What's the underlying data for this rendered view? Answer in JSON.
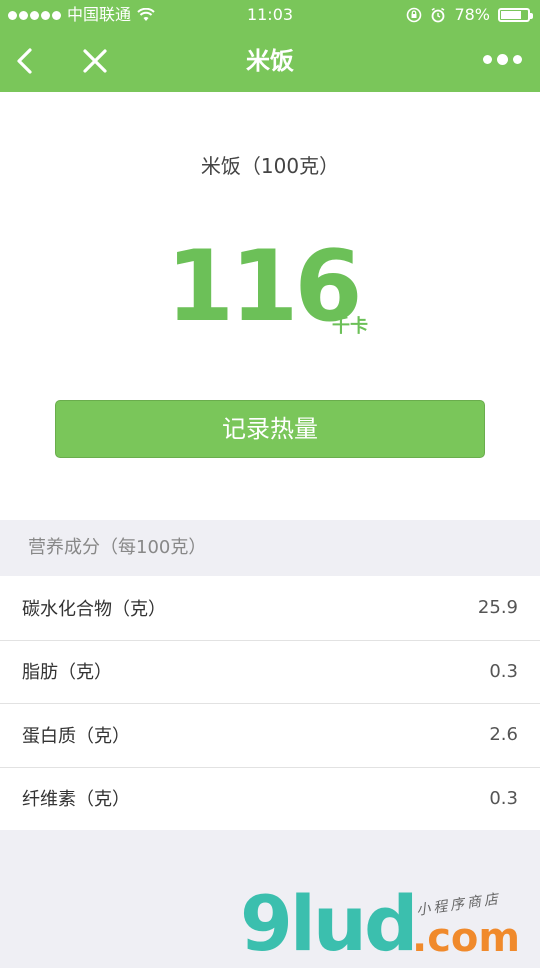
{
  "status_bar": {
    "carrier": "中国联通",
    "time": "11:03",
    "battery": "78%",
    "battery_level": 0.78
  },
  "nav": {
    "title": "米饭"
  },
  "food": {
    "name": "米饭（100克）",
    "calories": "116",
    "calories_unit": "千卡",
    "record_button_label": "记录热量"
  },
  "nutrition": {
    "header": "营养成分（每100克）",
    "rows": [
      {
        "label": "碳水化合物（克）",
        "value": "25.9"
      },
      {
        "label": "脂肪（克）",
        "value": "0.3"
      },
      {
        "label": "蛋白质（克）",
        "value": "2.6"
      },
      {
        "label": "纤维素（克）",
        "value": "0.3"
      }
    ]
  },
  "watermark": {
    "main": "9lud",
    "com": ".com",
    "tag": "小程序商店"
  },
  "colors": {
    "brand_green": "#7ac65a",
    "calorie_green": "#6cc058"
  }
}
